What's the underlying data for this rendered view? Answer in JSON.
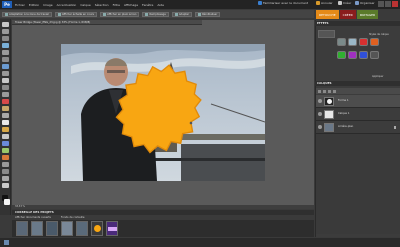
{
  "app": {
    "logo_text": "Pe",
    "menu": [
      "Fichier",
      "Edition",
      "Image",
      "Accentuation",
      "Calque",
      "Sélection",
      "Filtre",
      "Affichage",
      "Fenêtre",
      "Aide"
    ],
    "menu_right": [
      "Familiariser avec le document",
      "Annuler",
      "Créer",
      "Organiser"
    ],
    "colors": {
      "accent": "#e58a18",
      "menu_bg": "#232323",
      "panel_bg": "#3c3c3c"
    }
  },
  "options_bar": {
    "buttons": [
      "Adaptation à la zone de travail",
      "Afficher échelle en cours",
      "Afficher en plein écran",
      "Remplissage",
      "Adapter",
      "Réinitialiser"
    ]
  },
  "mode_tabs": [
    {
      "label": "RETOUCHE"
    },
    {
      "label": "CRÉER"
    },
    {
      "label": "PARTAGER"
    }
  ],
  "document": {
    "tab_title": "Tower Bridge (Tower_ENG_23.jpg @ 33% (Forme 1, RVB/8)",
    "status": "33,33 %"
  },
  "project_bin": {
    "title": "CORBEILLE DES PROJETS",
    "show_label": "Afficher documents ouverts",
    "thumb_label": "Fonds de corbeille",
    "thumbnails": [
      "photo-1",
      "photo-2",
      "photo-3",
      "photo-4",
      "photo-5",
      "starburst",
      "purple-graphic"
    ]
  },
  "effects_panel": {
    "title": "EFFETS",
    "label": "Styles de calque",
    "apply": "Appliquer"
  },
  "layers_panel": {
    "title": "CALQUES",
    "layers": [
      {
        "name": "Forme 1",
        "active": true
      },
      {
        "name": "Calque 1",
        "active": false
      },
      {
        "name": "Arrière-plan",
        "active": false
      }
    ]
  }
}
